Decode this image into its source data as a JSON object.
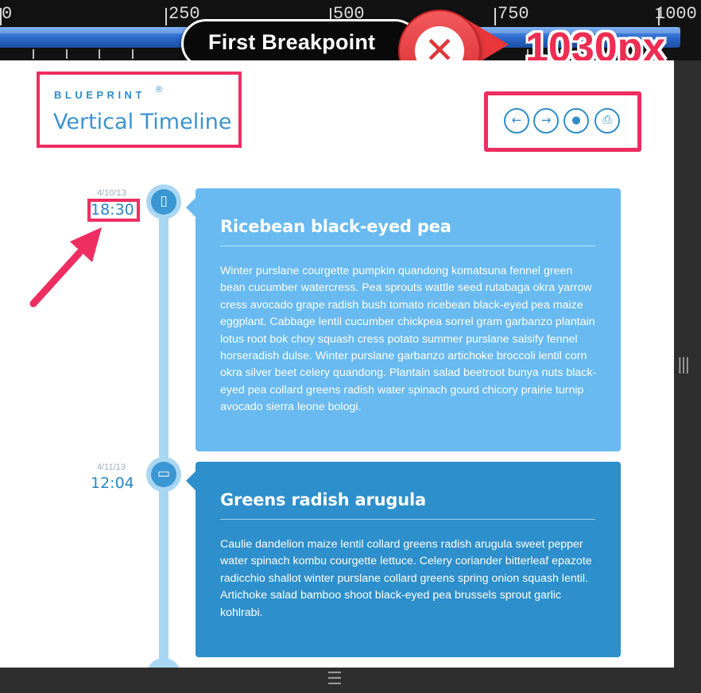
{
  "ruler": {
    "ticks": [
      {
        "label": "0",
        "value": 0
      },
      {
        "label": "250",
        "value": 250
      },
      {
        "label": "500",
        "value": 500
      },
      {
        "label": "750",
        "value": 750
      },
      {
        "label": "1000",
        "value": 1000
      }
    ],
    "bar_color": "#2a66c8"
  },
  "breakpoint": {
    "label": "First Breakpoint",
    "width_label": "1030px",
    "close_icon": "close-x-icon",
    "accent": "#e8363a"
  },
  "brand": {
    "name": "BLUEPRINT",
    "mark": "®",
    "title": "Vertical Timeline"
  },
  "nav": {
    "buttons": [
      {
        "icon": "arrow-left-icon",
        "glyph": "←"
      },
      {
        "icon": "arrow-right-icon",
        "glyph": "→"
      },
      {
        "icon": "drop-icon",
        "glyph": "💧"
      },
      {
        "icon": "inbox-icon",
        "glyph": "⎙"
      }
    ]
  },
  "timeline": {
    "entries": [
      {
        "date": "4/10/13",
        "time": "18:30",
        "icon": "phone-icon",
        "title": "Ricebean black-eyed pea",
        "body": "Winter purslane courgette pumpkin quandong komatsuna fennel green bean cucumber watercress. Pea sprouts wattle seed rutabaga okra yarrow cress avocado grape radish bush tomato ricebean black-eyed pea maize eggplant. Cabbage lentil cucumber chickpea sorrel gram garbanzo plantain lotus root bok choy squash cress potato summer purslane salsify fennel horseradish dulse. Winter purslane garbanzo artichoke broccoli lentil corn okra silver beet celery quandong. Plantain salad beetroot bunya nuts black-eyed pea collard greens radish water spinach gourd chicory prairie turnip avocado sierra leone bologi."
      },
      {
        "date": "4/11/13",
        "time": "12:04",
        "icon": "monitor-icon",
        "title": "Greens radish arugula",
        "body": "Caulie dandelion maize lentil collard greens radish arugula sweet pepper water spinach kombu courgette lettuce. Celery coriander bitterleaf epazote radicchio shallot winter purslane collard greens spring onion squash lentil. Artichoke salad bamboo shoot black-eyed pea brussels sprout garlic kohlrabi."
      }
    ]
  },
  "highlight_color": "#ee2d61"
}
